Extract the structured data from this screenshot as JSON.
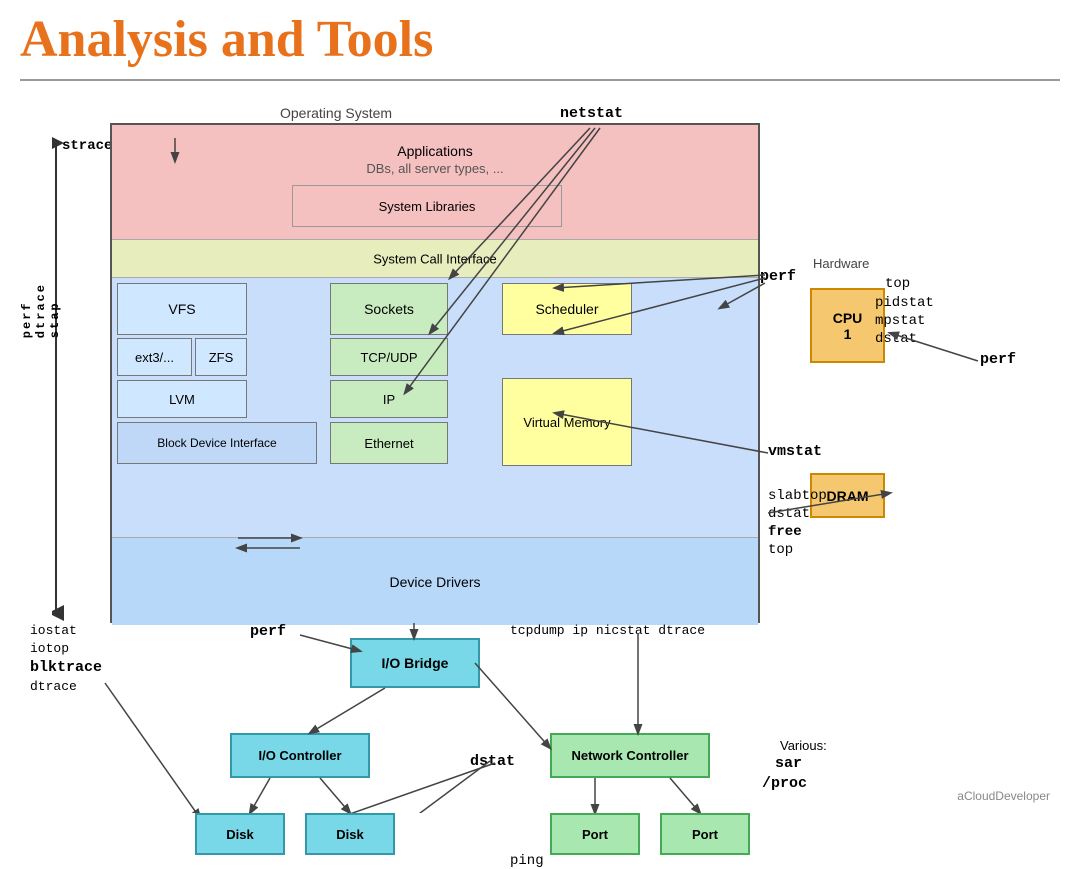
{
  "title": "Analysis and Tools",
  "diagram": {
    "os_label": "Operating System",
    "hardware_label": "Hardware",
    "layers": {
      "applications": {
        "line1": "Applications",
        "line2": "DBs, all server types, ..."
      },
      "system_libraries": "System Libraries",
      "syscall": "System Call Interface",
      "kernel_boxes": {
        "vfs": "VFS",
        "ext3": "ext3/...",
        "zfs": "ZFS",
        "lvm": "LVM",
        "bdi": "Block Device Interface",
        "sockets": "Sockets",
        "tcp": "TCP/UDP",
        "ip": "IP",
        "ethernet": "Ethernet",
        "scheduler": "Scheduler",
        "virtual_memory": "Virtual Memory"
      },
      "device_drivers": "Device Drivers"
    },
    "hardware_boxes": {
      "cpu": {
        "label": "CPU",
        "num": "1"
      },
      "dram": "DRAM"
    },
    "lower": {
      "io_bridge": "I/O Bridge",
      "io_controller": "I/O Controller",
      "disk1": "Disk",
      "disk2": "Disk",
      "net_controller": "Network Controller",
      "port1": "Port",
      "port2": "Port"
    },
    "tools_labels": {
      "strace": "strace",
      "netstat": "netstat",
      "perf_top": "perf",
      "top": "top",
      "pidstat": "pidstat",
      "mpstat": "mpstat",
      "dstat_top": "dstat",
      "perf_right": "perf",
      "vmstat": "vmstat",
      "slabtop": "slabtop",
      "dstat_mid": "dstat",
      "free": "free",
      "top2": "top",
      "iostat": "iostat",
      "iotop": "iotop",
      "blktrace": "blktrace",
      "dtrace": "dtrace",
      "perf_lower": "perf",
      "tcpdump": "tcpdump ip nicstat dtrace",
      "dstat_lower": "dstat",
      "ping": "ping",
      "various": "Various:",
      "sar": "sar",
      "proc": "/proc",
      "perf_dtrace_stap": "perf dtrace stap"
    }
  },
  "watermark": "aCloudDeveloper"
}
